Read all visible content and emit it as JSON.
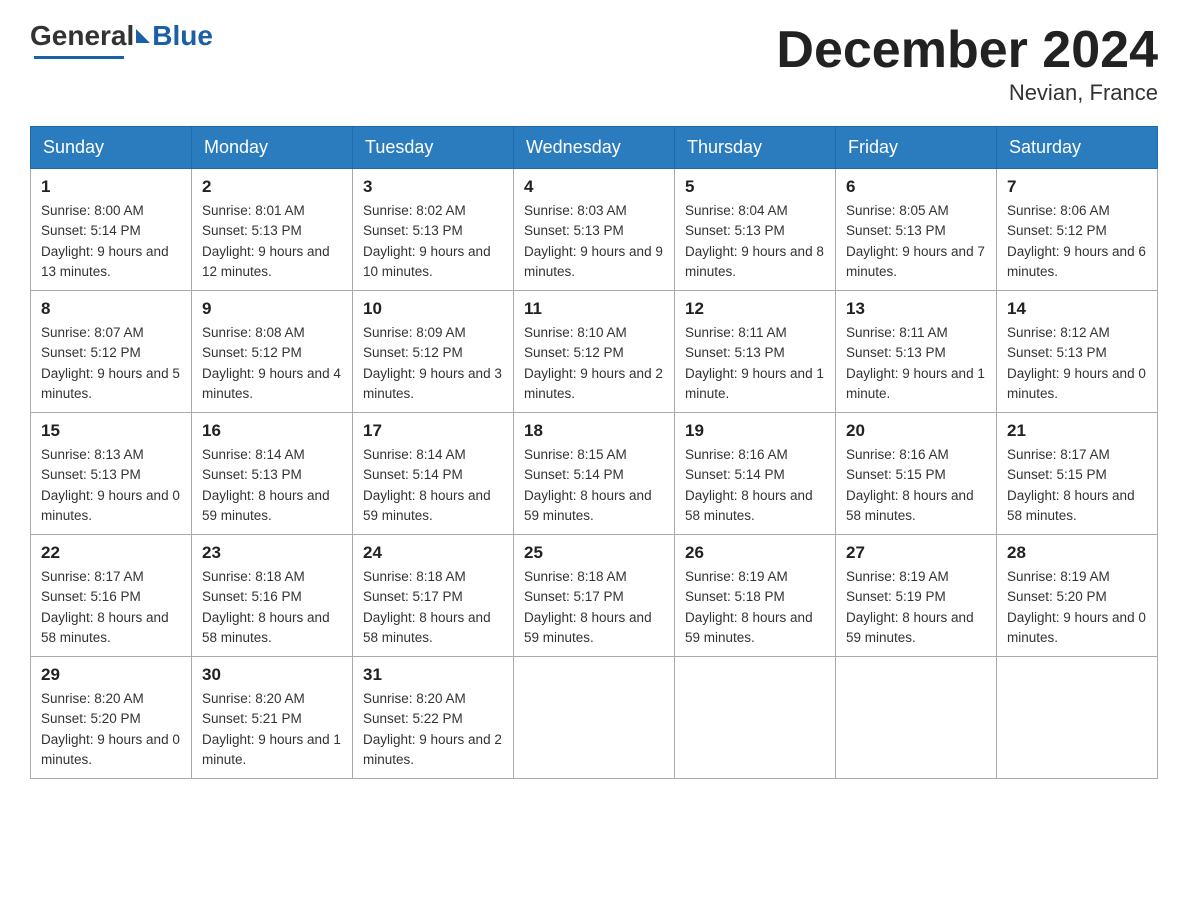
{
  "logo": {
    "general": "General",
    "blue": "Blue"
  },
  "header": {
    "month": "December 2024",
    "location": "Nevian, France"
  },
  "days_header": [
    "Sunday",
    "Monday",
    "Tuesday",
    "Wednesday",
    "Thursday",
    "Friday",
    "Saturday"
  ],
  "weeks": [
    [
      {
        "day": "1",
        "sunrise": "Sunrise: 8:00 AM",
        "sunset": "Sunset: 5:14 PM",
        "daylight": "Daylight: 9 hours and 13 minutes."
      },
      {
        "day": "2",
        "sunrise": "Sunrise: 8:01 AM",
        "sunset": "Sunset: 5:13 PM",
        "daylight": "Daylight: 9 hours and 12 minutes."
      },
      {
        "day": "3",
        "sunrise": "Sunrise: 8:02 AM",
        "sunset": "Sunset: 5:13 PM",
        "daylight": "Daylight: 9 hours and 10 minutes."
      },
      {
        "day": "4",
        "sunrise": "Sunrise: 8:03 AM",
        "sunset": "Sunset: 5:13 PM",
        "daylight": "Daylight: 9 hours and 9 minutes."
      },
      {
        "day": "5",
        "sunrise": "Sunrise: 8:04 AM",
        "sunset": "Sunset: 5:13 PM",
        "daylight": "Daylight: 9 hours and 8 minutes."
      },
      {
        "day": "6",
        "sunrise": "Sunrise: 8:05 AM",
        "sunset": "Sunset: 5:13 PM",
        "daylight": "Daylight: 9 hours and 7 minutes."
      },
      {
        "day": "7",
        "sunrise": "Sunrise: 8:06 AM",
        "sunset": "Sunset: 5:12 PM",
        "daylight": "Daylight: 9 hours and 6 minutes."
      }
    ],
    [
      {
        "day": "8",
        "sunrise": "Sunrise: 8:07 AM",
        "sunset": "Sunset: 5:12 PM",
        "daylight": "Daylight: 9 hours and 5 minutes."
      },
      {
        "day": "9",
        "sunrise": "Sunrise: 8:08 AM",
        "sunset": "Sunset: 5:12 PM",
        "daylight": "Daylight: 9 hours and 4 minutes."
      },
      {
        "day": "10",
        "sunrise": "Sunrise: 8:09 AM",
        "sunset": "Sunset: 5:12 PM",
        "daylight": "Daylight: 9 hours and 3 minutes."
      },
      {
        "day": "11",
        "sunrise": "Sunrise: 8:10 AM",
        "sunset": "Sunset: 5:12 PM",
        "daylight": "Daylight: 9 hours and 2 minutes."
      },
      {
        "day": "12",
        "sunrise": "Sunrise: 8:11 AM",
        "sunset": "Sunset: 5:13 PM",
        "daylight": "Daylight: 9 hours and 1 minute."
      },
      {
        "day": "13",
        "sunrise": "Sunrise: 8:11 AM",
        "sunset": "Sunset: 5:13 PM",
        "daylight": "Daylight: 9 hours and 1 minute."
      },
      {
        "day": "14",
        "sunrise": "Sunrise: 8:12 AM",
        "sunset": "Sunset: 5:13 PM",
        "daylight": "Daylight: 9 hours and 0 minutes."
      }
    ],
    [
      {
        "day": "15",
        "sunrise": "Sunrise: 8:13 AM",
        "sunset": "Sunset: 5:13 PM",
        "daylight": "Daylight: 9 hours and 0 minutes."
      },
      {
        "day": "16",
        "sunrise": "Sunrise: 8:14 AM",
        "sunset": "Sunset: 5:13 PM",
        "daylight": "Daylight: 8 hours and 59 minutes."
      },
      {
        "day": "17",
        "sunrise": "Sunrise: 8:14 AM",
        "sunset": "Sunset: 5:14 PM",
        "daylight": "Daylight: 8 hours and 59 minutes."
      },
      {
        "day": "18",
        "sunrise": "Sunrise: 8:15 AM",
        "sunset": "Sunset: 5:14 PM",
        "daylight": "Daylight: 8 hours and 59 minutes."
      },
      {
        "day": "19",
        "sunrise": "Sunrise: 8:16 AM",
        "sunset": "Sunset: 5:14 PM",
        "daylight": "Daylight: 8 hours and 58 minutes."
      },
      {
        "day": "20",
        "sunrise": "Sunrise: 8:16 AM",
        "sunset": "Sunset: 5:15 PM",
        "daylight": "Daylight: 8 hours and 58 minutes."
      },
      {
        "day": "21",
        "sunrise": "Sunrise: 8:17 AM",
        "sunset": "Sunset: 5:15 PM",
        "daylight": "Daylight: 8 hours and 58 minutes."
      }
    ],
    [
      {
        "day": "22",
        "sunrise": "Sunrise: 8:17 AM",
        "sunset": "Sunset: 5:16 PM",
        "daylight": "Daylight: 8 hours and 58 minutes."
      },
      {
        "day": "23",
        "sunrise": "Sunrise: 8:18 AM",
        "sunset": "Sunset: 5:16 PM",
        "daylight": "Daylight: 8 hours and 58 minutes."
      },
      {
        "day": "24",
        "sunrise": "Sunrise: 8:18 AM",
        "sunset": "Sunset: 5:17 PM",
        "daylight": "Daylight: 8 hours and 58 minutes."
      },
      {
        "day": "25",
        "sunrise": "Sunrise: 8:18 AM",
        "sunset": "Sunset: 5:17 PM",
        "daylight": "Daylight: 8 hours and 59 minutes."
      },
      {
        "day": "26",
        "sunrise": "Sunrise: 8:19 AM",
        "sunset": "Sunset: 5:18 PM",
        "daylight": "Daylight: 8 hours and 59 minutes."
      },
      {
        "day": "27",
        "sunrise": "Sunrise: 8:19 AM",
        "sunset": "Sunset: 5:19 PM",
        "daylight": "Daylight: 8 hours and 59 minutes."
      },
      {
        "day": "28",
        "sunrise": "Sunrise: 8:19 AM",
        "sunset": "Sunset: 5:20 PM",
        "daylight": "Daylight: 9 hours and 0 minutes."
      }
    ],
    [
      {
        "day": "29",
        "sunrise": "Sunrise: 8:20 AM",
        "sunset": "Sunset: 5:20 PM",
        "daylight": "Daylight: 9 hours and 0 minutes."
      },
      {
        "day": "30",
        "sunrise": "Sunrise: 8:20 AM",
        "sunset": "Sunset: 5:21 PM",
        "daylight": "Daylight: 9 hours and 1 minute."
      },
      {
        "day": "31",
        "sunrise": "Sunrise: 8:20 AM",
        "sunset": "Sunset: 5:22 PM",
        "daylight": "Daylight: 9 hours and 2 minutes."
      },
      null,
      null,
      null,
      null
    ]
  ]
}
